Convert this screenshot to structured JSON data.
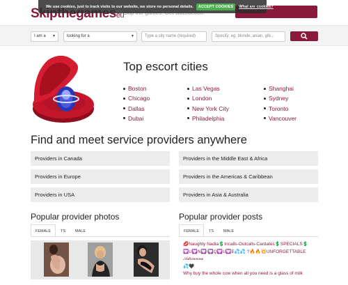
{
  "header": {
    "logo_text": "Skipthegames",
    "logo_suffix": "eu",
    "tagline": "Skip the games. Get satisfaction."
  },
  "cookie_bar": {
    "text": "We use cookies, just to track visits to our website, we store no personal details.",
    "accept_label": "ACCEPT COOKIES",
    "more_label": "What are cookies?"
  },
  "search": {
    "iam_value": "I am a",
    "lookingfor_value": "looking for a",
    "city_placeholder": "Type a city name (required)",
    "specify_placeholder": "Specify, eg: blonde, asian, gfe..."
  },
  "hero": {
    "title": "Top escort cities",
    "cities_col1": [
      "Boston",
      "Chicago",
      "Dallas",
      "Dubai"
    ],
    "cities_col2": [
      "Las Vegas",
      "London",
      "New York City",
      "Philadelphia"
    ],
    "cities_col3": [
      "Shanghai",
      "Sydney",
      "Toronto",
      "Vancouver"
    ]
  },
  "providers": {
    "title": "Find and meet service providers anywhere",
    "items": [
      "Providers in Canada",
      "Providers in the Middle East & Africa",
      "Providers in Europe",
      "Providers in the Americas & Caribbean",
      "Providers in USA",
      "Providers in Asia & Australia"
    ]
  },
  "photos": {
    "title": "Popular provider photos",
    "tabs": [
      "FEMALE",
      "TS",
      "MALE"
    ]
  },
  "posts": {
    "title": "Popular provider posts",
    "tabs": [
      "FEMALE",
      "TS",
      "MALE"
    ],
    "items": [
      "💋Naughty Nadia💲Incalls-Outcalls-Cardates💲SPECIALS💲",
      "💟U💟N💟I💟Q💟U💟E💦💦 ?🔥🔥💥UNFORGETTABLE 𝒜𝒹𝓇𝒾𝒶𝓃𝓃𝒶",
      "💦🖤",
      "Why buy the whole cow when all you need is a glass of milk"
    ]
  },
  "colors": {
    "brand": "#8a1a3b",
    "accept": "#4caf50"
  }
}
